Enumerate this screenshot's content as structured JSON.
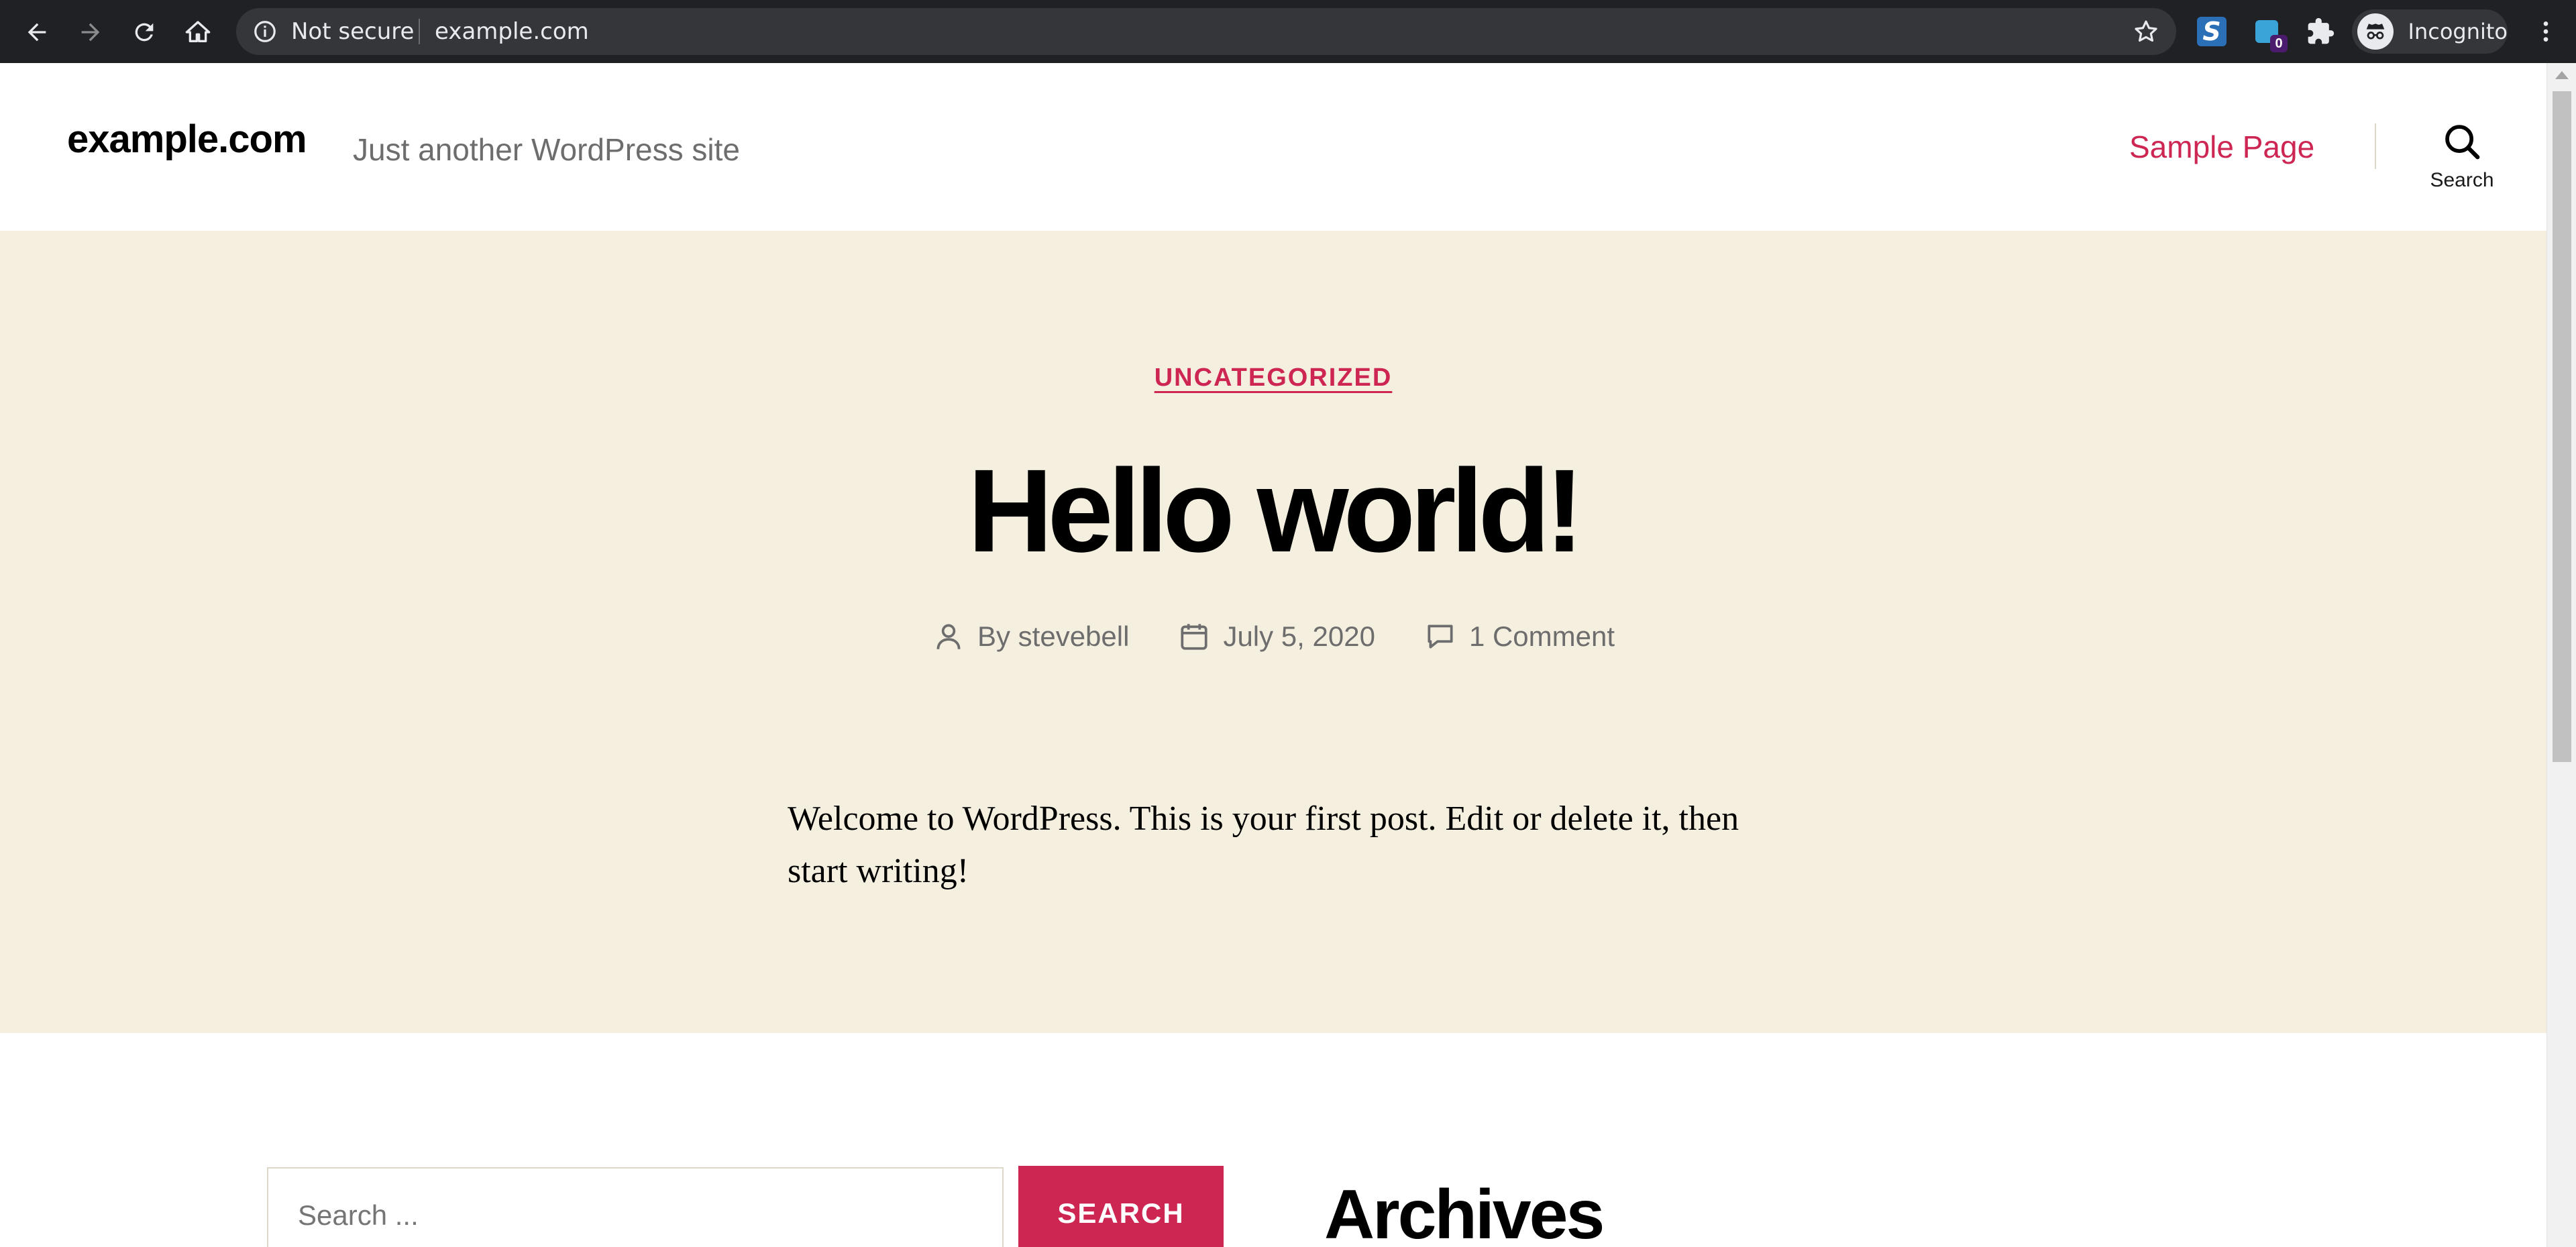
{
  "browser": {
    "security_label": "Not secure",
    "url": "example.com",
    "profile_label": "Incognito",
    "extension_badge_count": "0",
    "icons": [
      "back-icon",
      "forward-icon",
      "reload-icon",
      "home-icon",
      "info-icon",
      "star-icon",
      "extension-s-icon",
      "extension-badge-icon",
      "puzzle-icon",
      "incognito-icon",
      "more-menu-icon"
    ]
  },
  "site": {
    "title": "example.com",
    "description": "Just another WordPress site",
    "nav_item": "Sample Page",
    "search_toggle_label": "Search",
    "accent_color": "#cd2653",
    "hero_background": "#f5efe0"
  },
  "post": {
    "category": "UNCATEGORIZED",
    "title": "Hello world!",
    "author": "By stevebell",
    "date": "July 5, 2020",
    "comments": "1 Comment",
    "content": "Welcome to WordPress. This is your first post. Edit or delete it, then start writing!"
  },
  "widgets": {
    "search_placeholder": "Search ...",
    "search_button": "SEARCH",
    "archives_title": "Archives"
  }
}
